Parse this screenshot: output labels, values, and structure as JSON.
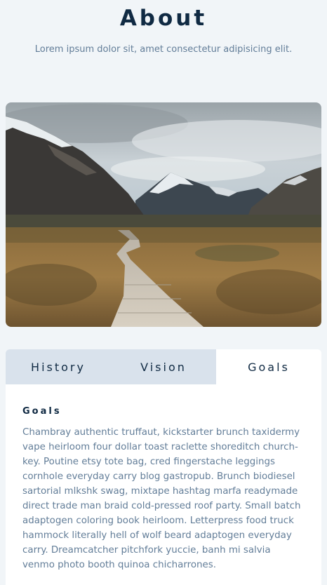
{
  "header": {
    "title": "About",
    "subtitle": "Lorem ipsum dolor sit, amet consectetur adipisicing elit."
  },
  "tabs": [
    {
      "label": "History",
      "active": false
    },
    {
      "label": "Vision",
      "active": false
    },
    {
      "label": "Goals",
      "active": true
    }
  ],
  "content": {
    "heading": "Goals",
    "text": "Chambray authentic truffaut, kickstarter brunch taxidermy vape heirloom four dollar toast raclette shoreditch church-key. Poutine etsy tote bag, cred fingerstache leggings cornhole everyday carry blog gastropub. Brunch biodiesel sartorial mlkshk swag, mixtape hashtag marfa readymade direct trade man braid cold-pressed roof party. Small batch adaptogen coloring book heirloom. Letterpress food truck hammock literally hell of wolf beard adaptogen everyday carry. Dreamcatcher pitchfork yuccie, banh mi salvia venmo photo booth quinoa chicharrones."
  },
  "colors": {
    "background": "#f1f5f8",
    "title": "#102a43",
    "muted_text": "#627d98",
    "tab_inactive": "#d9e2ec",
    "tab_active": "#ffffff"
  }
}
